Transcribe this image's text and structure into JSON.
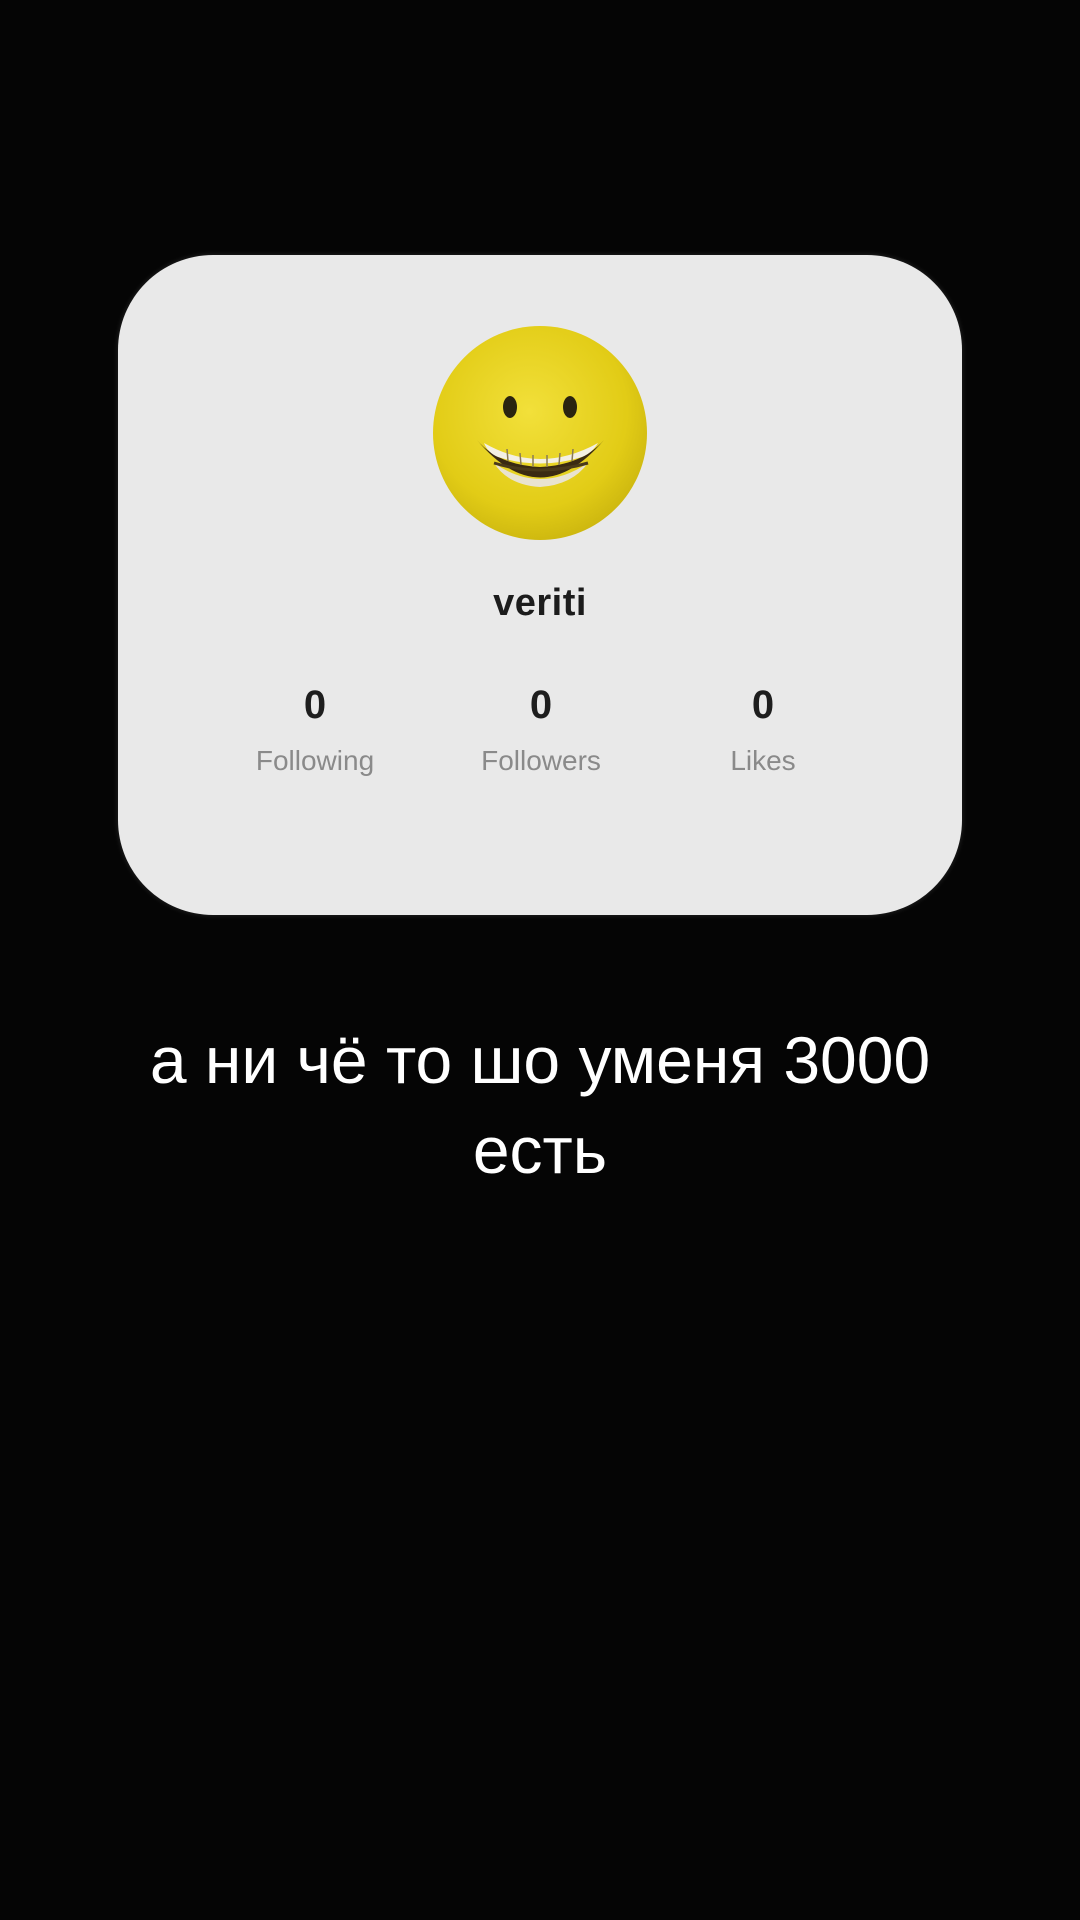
{
  "profile": {
    "username": "veriti",
    "avatar_icon": "smiley-face-icon",
    "stats": [
      {
        "value": "0",
        "label": "Following"
      },
      {
        "value": "0",
        "label": "Followers"
      },
      {
        "value": "0",
        "label": "Likes"
      }
    ]
  },
  "caption": {
    "line1": "а ни чё то шо уменя 3000",
    "line2": "есть"
  },
  "colors": {
    "background": "#050505",
    "card": "#e9e9e9",
    "avatar_yellow": "#e6d21a",
    "caption_text": "#ffffff"
  }
}
